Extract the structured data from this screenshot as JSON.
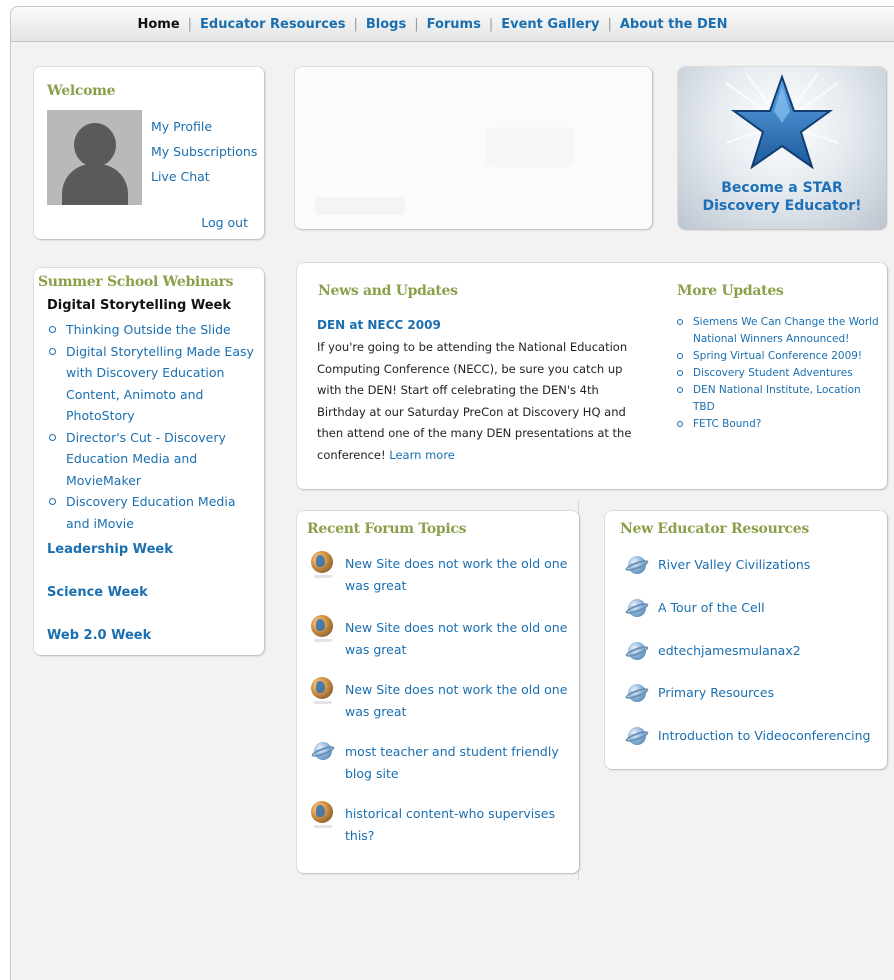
{
  "nav": {
    "items": [
      {
        "label": "Home",
        "active": true
      },
      {
        "label": "Educator Resources",
        "active": false
      },
      {
        "label": "Blogs",
        "active": false
      },
      {
        "label": "Forums",
        "active": false
      },
      {
        "label": "Event Gallery",
        "active": false
      },
      {
        "label": "About the DEN",
        "active": false
      }
    ],
    "separator": "|"
  },
  "welcome": {
    "title": "Welcome",
    "links": [
      "My Profile",
      "My Subscriptions",
      "Live Chat"
    ],
    "logout": "Log out"
  },
  "star_banner": {
    "line1": "Become a STAR",
    "line2": "Discovery Educator!"
  },
  "webinars": {
    "title": "Summer School Webinars",
    "current_week": "Digital Storytelling Week",
    "sessions": [
      "Thinking Outside the Slide",
      "Digital Storytelling Made Easy with Discovery Education Content, Animoto and PhotoStory",
      "Director's Cut - Discovery Education Media and MovieMaker",
      "Discovery Education Media and iMovie"
    ],
    "other_weeks": [
      "Leadership Week",
      "Science Week",
      "Web 2.0 Week"
    ]
  },
  "news": {
    "title": "News and Updates",
    "headline": "DEN at NECC 2009",
    "body": "If you're going to be attending the National Education Computing Conference (NECC), be sure you catch up with the DEN! Start off celebrating the DEN's 4th Birthday at our Saturday PreCon at Discovery HQ and then attend one of the many DEN presentations at the conference!",
    "learn_more": "Learn more",
    "more_title": "More Updates",
    "more_items": [
      "Siemens We Can Change the World National Winners Announced!",
      "Spring Virtual Conference 2009!",
      "Discovery Student Adventures",
      "DEN National Institute, Location TBD",
      "FETC Bound?"
    ]
  },
  "forum": {
    "title": "Recent Forum Topics",
    "topics": [
      {
        "text": "New Site does not work the old one was great",
        "icon": "earth-globe-icon"
      },
      {
        "text": "New Site does not work the old one was great",
        "icon": "earth-globe-icon"
      },
      {
        "text": "New Site does not work the old one was great",
        "icon": "earth-globe-icon"
      },
      {
        "text": "most teacher and student friendly blog site",
        "icon": "satellite-globe-icon"
      },
      {
        "text": "historical content-who supervises this?",
        "icon": "earth-globe-icon"
      }
    ]
  },
  "resources": {
    "title": "New Educator Resources",
    "items": [
      "River Valley Civilizations",
      "A Tour of the Cell",
      "edtechjamesmulanax2",
      "Primary Resources",
      "Introduction to Videoconferencing"
    ]
  },
  "colors": {
    "link": "#1a6fb0",
    "panel_title": "#8aa04a",
    "background": "#f2f2f2"
  }
}
